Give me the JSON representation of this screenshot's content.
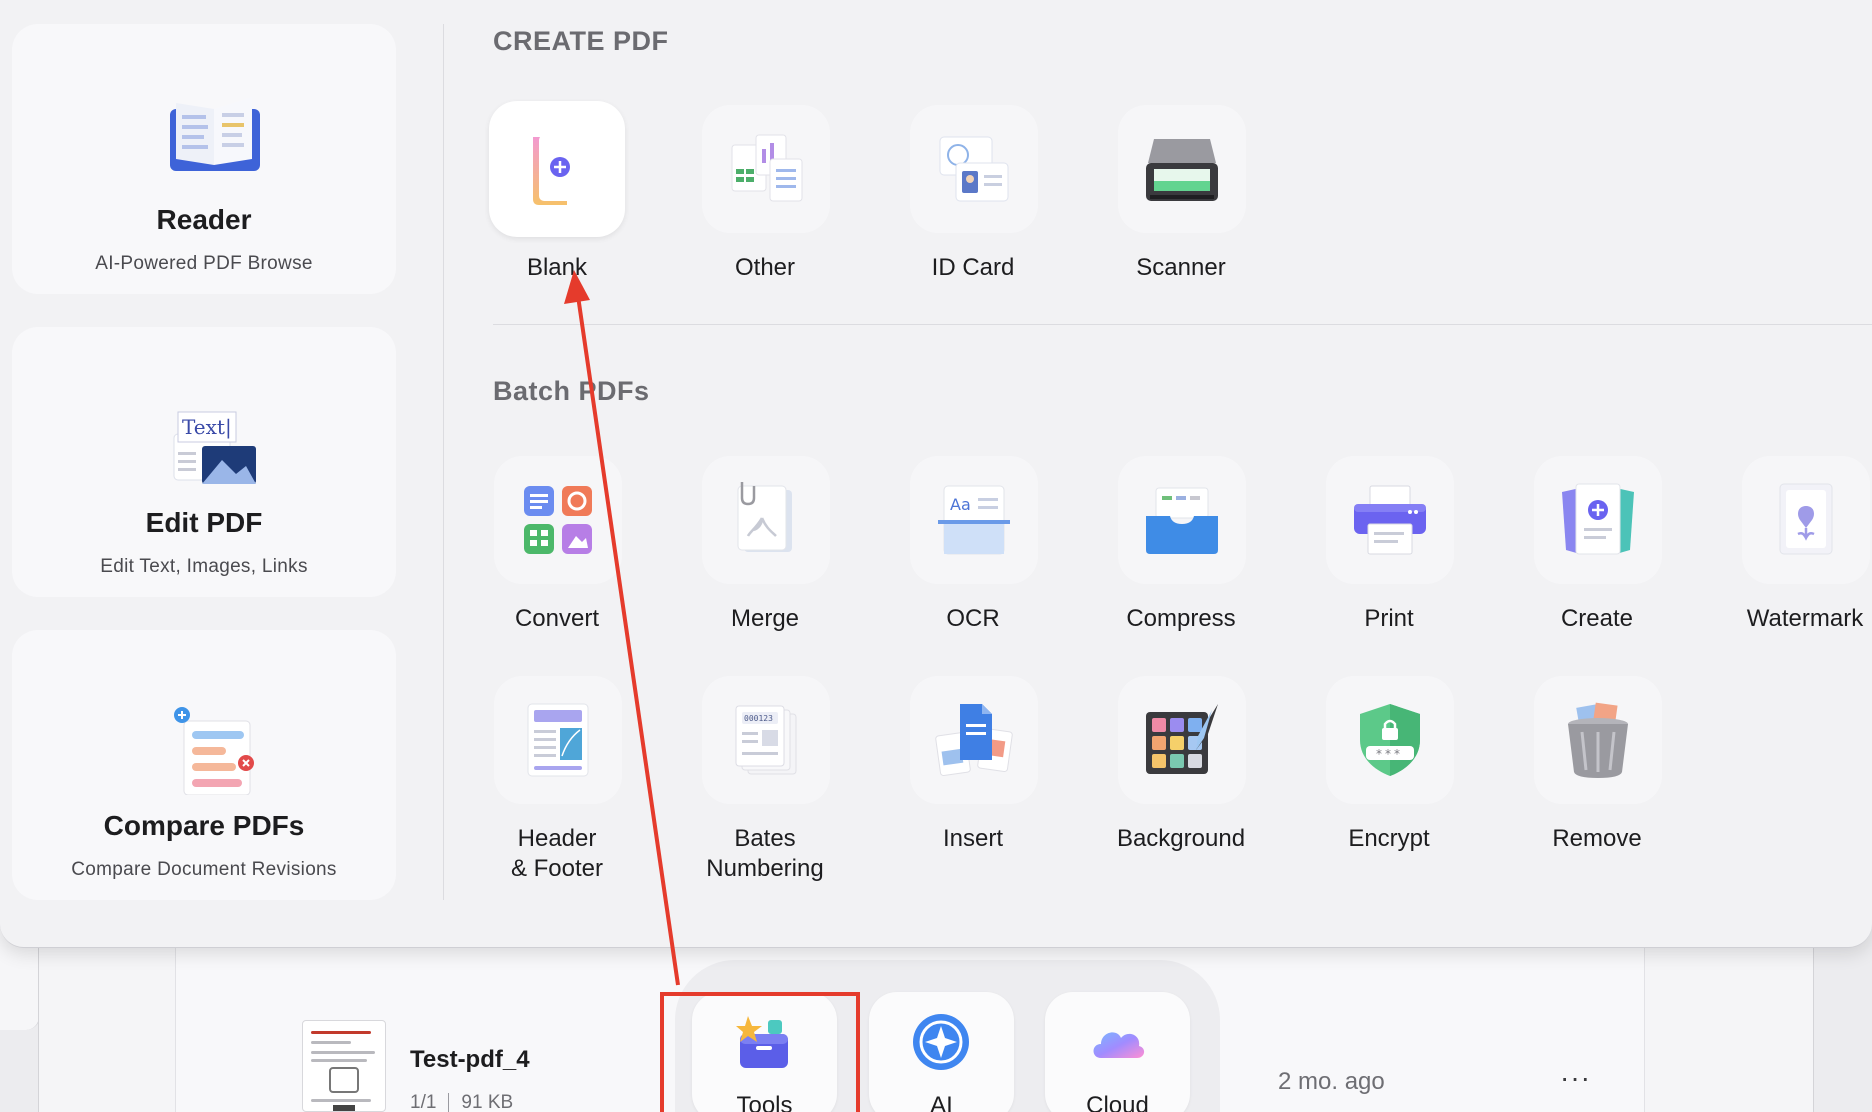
{
  "sidebar": {
    "cards": [
      {
        "title": "Reader",
        "subtitle": "AI-Powered PDF Browse",
        "icon": "book-icon"
      },
      {
        "title": "Edit PDF",
        "subtitle": "Edit Text, Images, Links",
        "icon": "edit-text-image-icon",
        "icon_text": "Text|"
      },
      {
        "title": "Compare PDFs",
        "subtitle": "Compare Document Revisions",
        "icon": "compare-docs-icon"
      }
    ]
  },
  "create": {
    "title": "CREATE PDF",
    "tools": [
      {
        "label": "Blank",
        "icon": "blank-page-plus-icon"
      },
      {
        "label": "Other",
        "icon": "other-documents-icon"
      },
      {
        "label": "ID Card",
        "icon": "id-card-icon"
      },
      {
        "label": "Scanner",
        "icon": "scanner-icon"
      }
    ]
  },
  "batch": {
    "title": "Batch PDFs",
    "tools": [
      {
        "label": "Convert",
        "icon": "convert-icon"
      },
      {
        "label": "Merge",
        "icon": "merge-icon"
      },
      {
        "label": "OCR",
        "icon": "ocr-icon",
        "icon_text": "Aa"
      },
      {
        "label": "Compress",
        "icon": "compress-icon"
      },
      {
        "label": "Print",
        "icon": "printer-icon"
      },
      {
        "label": "Create",
        "icon": "create-icon"
      },
      {
        "label": "Watermark",
        "icon": "watermark-icon"
      },
      {
        "label_line1": "Header",
        "label_line2": "& Footer",
        "icon": "header-footer-icon"
      },
      {
        "label_line1": "Bates",
        "label_line2": "Numbering",
        "icon": "bates-numbering-icon",
        "icon_text": "000123"
      },
      {
        "label": "Insert",
        "icon": "insert-icon"
      },
      {
        "label": "Background",
        "icon": "background-palette-icon"
      },
      {
        "label": "Encrypt",
        "icon": "encrypt-shield-icon",
        "icon_text": "***"
      },
      {
        "label": "Remove",
        "icon": "trash-icon"
      }
    ]
  },
  "file": {
    "name": "Test-pdf_4",
    "pages": "1/1",
    "size": "91 KB",
    "modified": "2 mo. ago",
    "more": "···"
  },
  "dock": {
    "items": [
      {
        "label": "Tools",
        "icon": "tools-icon"
      },
      {
        "label": "AI",
        "icon": "ai-icon"
      },
      {
        "label": "Cloud",
        "icon": "cloud-icon"
      }
    ]
  },
  "colors": {
    "annotation": "#e53b2c",
    "accent": "#6a63f0"
  }
}
